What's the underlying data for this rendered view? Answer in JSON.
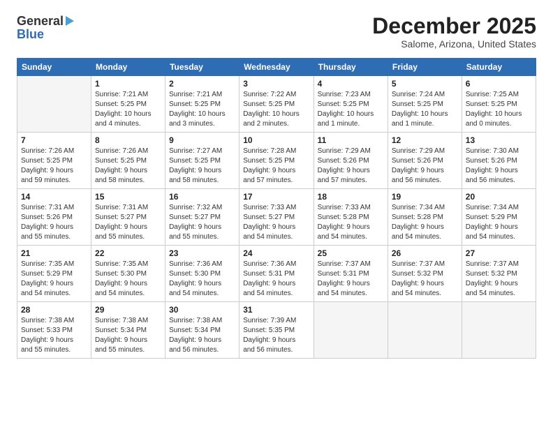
{
  "header": {
    "logo_line1": "General",
    "logo_line2": "Blue",
    "title": "December 2025",
    "subtitle": "Salome, Arizona, United States"
  },
  "days_of_week": [
    "Sunday",
    "Monday",
    "Tuesday",
    "Wednesday",
    "Thursday",
    "Friday",
    "Saturday"
  ],
  "weeks": [
    [
      {
        "day": "",
        "info": ""
      },
      {
        "day": "1",
        "info": "Sunrise: 7:21 AM\nSunset: 5:25 PM\nDaylight: 10 hours\nand 4 minutes."
      },
      {
        "day": "2",
        "info": "Sunrise: 7:21 AM\nSunset: 5:25 PM\nDaylight: 10 hours\nand 3 minutes."
      },
      {
        "day": "3",
        "info": "Sunrise: 7:22 AM\nSunset: 5:25 PM\nDaylight: 10 hours\nand 2 minutes."
      },
      {
        "day": "4",
        "info": "Sunrise: 7:23 AM\nSunset: 5:25 PM\nDaylight: 10 hours\nand 1 minute."
      },
      {
        "day": "5",
        "info": "Sunrise: 7:24 AM\nSunset: 5:25 PM\nDaylight: 10 hours\nand 1 minute."
      },
      {
        "day": "6",
        "info": "Sunrise: 7:25 AM\nSunset: 5:25 PM\nDaylight: 10 hours\nand 0 minutes."
      }
    ],
    [
      {
        "day": "7",
        "info": "Sunrise: 7:26 AM\nSunset: 5:25 PM\nDaylight: 9 hours\nand 59 minutes."
      },
      {
        "day": "8",
        "info": "Sunrise: 7:26 AM\nSunset: 5:25 PM\nDaylight: 9 hours\nand 58 minutes."
      },
      {
        "day": "9",
        "info": "Sunrise: 7:27 AM\nSunset: 5:25 PM\nDaylight: 9 hours\nand 58 minutes."
      },
      {
        "day": "10",
        "info": "Sunrise: 7:28 AM\nSunset: 5:25 PM\nDaylight: 9 hours\nand 57 minutes."
      },
      {
        "day": "11",
        "info": "Sunrise: 7:29 AM\nSunset: 5:26 PM\nDaylight: 9 hours\nand 57 minutes."
      },
      {
        "day": "12",
        "info": "Sunrise: 7:29 AM\nSunset: 5:26 PM\nDaylight: 9 hours\nand 56 minutes."
      },
      {
        "day": "13",
        "info": "Sunrise: 7:30 AM\nSunset: 5:26 PM\nDaylight: 9 hours\nand 56 minutes."
      }
    ],
    [
      {
        "day": "14",
        "info": "Sunrise: 7:31 AM\nSunset: 5:26 PM\nDaylight: 9 hours\nand 55 minutes."
      },
      {
        "day": "15",
        "info": "Sunrise: 7:31 AM\nSunset: 5:27 PM\nDaylight: 9 hours\nand 55 minutes."
      },
      {
        "day": "16",
        "info": "Sunrise: 7:32 AM\nSunset: 5:27 PM\nDaylight: 9 hours\nand 55 minutes."
      },
      {
        "day": "17",
        "info": "Sunrise: 7:33 AM\nSunset: 5:27 PM\nDaylight: 9 hours\nand 54 minutes."
      },
      {
        "day": "18",
        "info": "Sunrise: 7:33 AM\nSunset: 5:28 PM\nDaylight: 9 hours\nand 54 minutes."
      },
      {
        "day": "19",
        "info": "Sunrise: 7:34 AM\nSunset: 5:28 PM\nDaylight: 9 hours\nand 54 minutes."
      },
      {
        "day": "20",
        "info": "Sunrise: 7:34 AM\nSunset: 5:29 PM\nDaylight: 9 hours\nand 54 minutes."
      }
    ],
    [
      {
        "day": "21",
        "info": "Sunrise: 7:35 AM\nSunset: 5:29 PM\nDaylight: 9 hours\nand 54 minutes."
      },
      {
        "day": "22",
        "info": "Sunrise: 7:35 AM\nSunset: 5:30 PM\nDaylight: 9 hours\nand 54 minutes."
      },
      {
        "day": "23",
        "info": "Sunrise: 7:36 AM\nSunset: 5:30 PM\nDaylight: 9 hours\nand 54 minutes."
      },
      {
        "day": "24",
        "info": "Sunrise: 7:36 AM\nSunset: 5:31 PM\nDaylight: 9 hours\nand 54 minutes."
      },
      {
        "day": "25",
        "info": "Sunrise: 7:37 AM\nSunset: 5:31 PM\nDaylight: 9 hours\nand 54 minutes."
      },
      {
        "day": "26",
        "info": "Sunrise: 7:37 AM\nSunset: 5:32 PM\nDaylight: 9 hours\nand 54 minutes."
      },
      {
        "day": "27",
        "info": "Sunrise: 7:37 AM\nSunset: 5:32 PM\nDaylight: 9 hours\nand 54 minutes."
      }
    ],
    [
      {
        "day": "28",
        "info": "Sunrise: 7:38 AM\nSunset: 5:33 PM\nDaylight: 9 hours\nand 55 minutes."
      },
      {
        "day": "29",
        "info": "Sunrise: 7:38 AM\nSunset: 5:34 PM\nDaylight: 9 hours\nand 55 minutes."
      },
      {
        "day": "30",
        "info": "Sunrise: 7:38 AM\nSunset: 5:34 PM\nDaylight: 9 hours\nand 56 minutes."
      },
      {
        "day": "31",
        "info": "Sunrise: 7:39 AM\nSunset: 5:35 PM\nDaylight: 9 hours\nand 56 minutes."
      },
      {
        "day": "",
        "info": ""
      },
      {
        "day": "",
        "info": ""
      },
      {
        "day": "",
        "info": ""
      }
    ]
  ]
}
